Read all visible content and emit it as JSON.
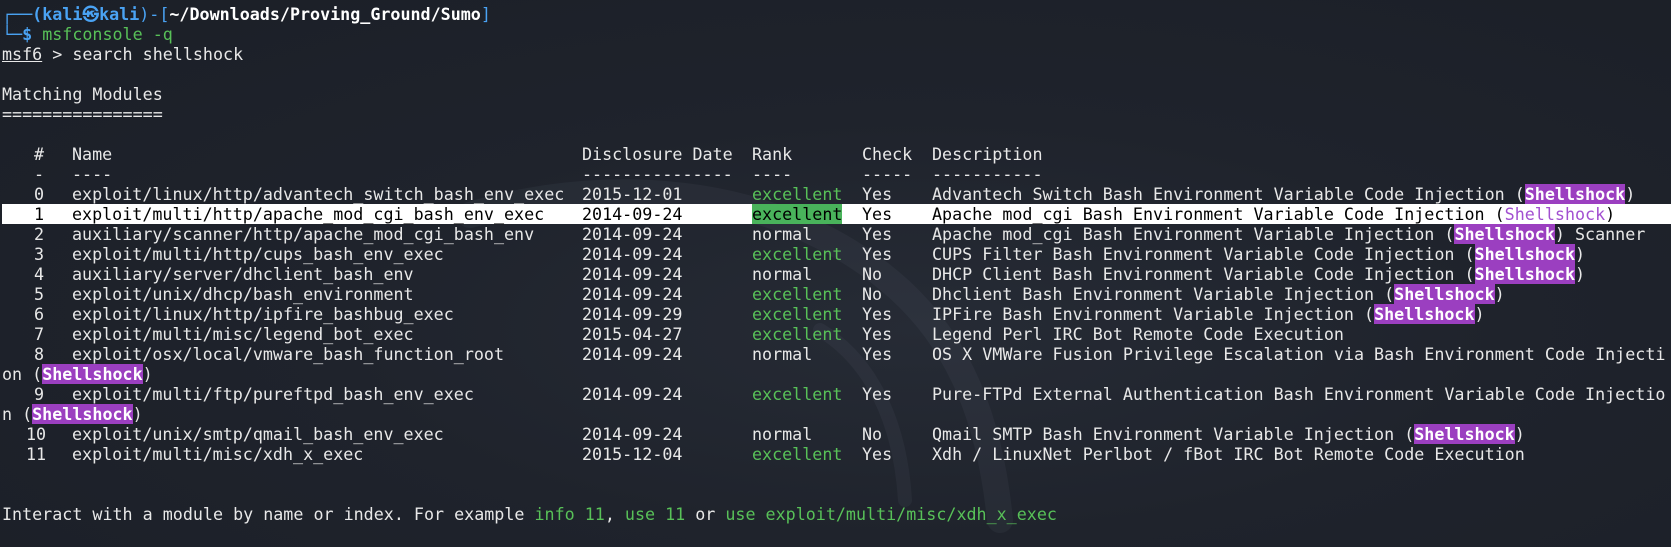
{
  "prompt": {
    "corner_top": "┌──(",
    "user": "kali",
    "at": "㉿",
    "host": "kali",
    "mid": ")-[",
    "path": "~/Downloads/Proving_Ground/Sumo",
    "close": "]",
    "corner_bottom": "└─",
    "dollar": "$ ",
    "command": "msfconsole -q"
  },
  "msf": {
    "prompt": "msf6",
    "sep": " > ",
    "command": "search shellshock"
  },
  "heading": "Matching Modules",
  "heading_underline": "================",
  "columns": {
    "num": "#",
    "name": "Name",
    "date": "Disclosure Date",
    "rank": "Rank",
    "check": "Check",
    "desc": "Description"
  },
  "column_underlines": {
    "num": "-",
    "name": "----",
    "date": "---------------",
    "rank": "----",
    "check": "-----",
    "desc": "-----------"
  },
  "highlight_word": "Shellshock",
  "selected_row": 1,
  "modules": [
    {
      "num": "0",
      "name": "exploit/linux/http/advantech_switch_bash_env_exec",
      "date": "2015-12-01",
      "rank": "excellent",
      "check": "Yes",
      "desc_pre": "Advantech Switch Bash Environment Variable Code Injection (",
      "desc_post": ")",
      "wrap_pre": "",
      "wrap_post": ""
    },
    {
      "num": "1",
      "name": "exploit/multi/http/apache_mod_cgi_bash_env_exec",
      "date": "2014-09-24",
      "rank": "excellent",
      "check": "Yes",
      "desc_pre": "Apache mod_cgi Bash Environment Variable Code Injection (",
      "desc_post": ")",
      "wrap_pre": "",
      "wrap_post": ""
    },
    {
      "num": "2",
      "name": "auxiliary/scanner/http/apache_mod_cgi_bash_env",
      "date": "2014-09-24",
      "rank": "normal",
      "check": "Yes",
      "desc_pre": "Apache mod_cgi Bash Environment Variable Injection (",
      "desc_post": ") Scanner",
      "wrap_pre": "",
      "wrap_post": ""
    },
    {
      "num": "3",
      "name": "exploit/multi/http/cups_bash_env_exec",
      "date": "2014-09-24",
      "rank": "excellent",
      "check": "Yes",
      "desc_pre": "CUPS Filter Bash Environment Variable Code Injection (",
      "desc_post": ")",
      "wrap_pre": "",
      "wrap_post": ""
    },
    {
      "num": "4",
      "name": "auxiliary/server/dhclient_bash_env",
      "date": "2014-09-24",
      "rank": "normal",
      "check": "No",
      "desc_pre": "DHCP Client Bash Environment Variable Code Injection (",
      "desc_post": ")",
      "wrap_pre": "",
      "wrap_post": ""
    },
    {
      "num": "5",
      "name": "exploit/unix/dhcp/bash_environment",
      "date": "2014-09-24",
      "rank": "excellent",
      "check": "No",
      "desc_pre": "Dhclient Bash Environment Variable Injection (",
      "desc_post": ")",
      "wrap_pre": "",
      "wrap_post": ""
    },
    {
      "num": "6",
      "name": "exploit/linux/http/ipfire_bashbug_exec",
      "date": "2014-09-29",
      "rank": "excellent",
      "check": "Yes",
      "desc_pre": "IPFire Bash Environment Variable Injection (",
      "desc_post": ")",
      "wrap_pre": "",
      "wrap_post": ""
    },
    {
      "num": "7",
      "name": "exploit/multi/misc/legend_bot_exec",
      "date": "2015-04-27",
      "rank": "excellent",
      "check": "Yes",
      "desc_pre": "Legend Perl IRC Bot Remote Code Execution",
      "desc_post": "",
      "wrap_pre": "",
      "wrap_post": ""
    },
    {
      "num": "8",
      "name": "exploit/osx/local/vmware_bash_function_root",
      "date": "2014-09-24",
      "rank": "normal",
      "check": "Yes",
      "desc_pre": "OS X VMWare Fusion Privilege Escalation via Bash Environment Code Injecti",
      "desc_post": "",
      "wrap_pre": "on (",
      "wrap_post": ")"
    },
    {
      "num": "9",
      "name": "exploit/multi/ftp/pureftpd_bash_env_exec",
      "date": "2014-09-24",
      "rank": "excellent",
      "check": "Yes",
      "desc_pre": "Pure-FTPd External Authentication Bash Environment Variable Code Injectio",
      "desc_post": "",
      "wrap_pre": "n (",
      "wrap_post": ")"
    },
    {
      "num": "10",
      "name": "exploit/unix/smtp/qmail_bash_env_exec",
      "date": "2014-09-24",
      "rank": "normal",
      "check": "No",
      "desc_pre": "Qmail SMTP Bash Environment Variable Injection (",
      "desc_post": ")",
      "wrap_pre": "",
      "wrap_post": ""
    },
    {
      "num": "11",
      "name": "exploit/multi/misc/xdh_x_exec",
      "date": "2015-12-04",
      "rank": "excellent",
      "check": "Yes",
      "desc_pre": "Xdh / LinuxNet Perlbot / fBot IRC Bot Remote Code Execution",
      "desc_post": "",
      "wrap_pre": "",
      "wrap_post": ""
    }
  ],
  "footer": {
    "text1": "Interact with a module by name or index. For example ",
    "cmd1": "info 11",
    "sep1": ", ",
    "cmd2": "use 11",
    "sep2": " or ",
    "cmd3": "use exploit/multi/misc/xdh_x_exec"
  },
  "colors": {
    "background": "#1e222b",
    "prompt_blue": "#4aa3f4",
    "excellent_green": "#58c158",
    "shellshock_purple": "#9b3fc0",
    "selected_rank_bg": "#49b35b"
  }
}
